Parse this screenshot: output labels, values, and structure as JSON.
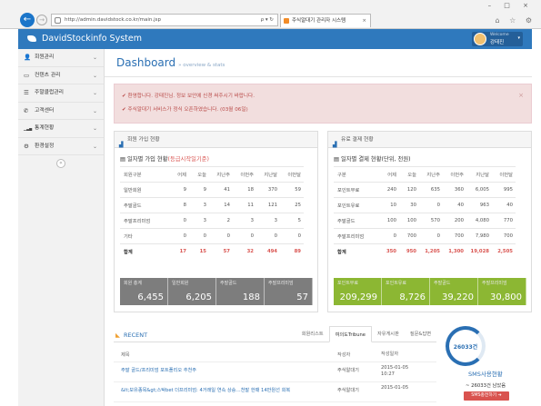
{
  "browser": {
    "url": "http://admin.davidstock.co.kr/main.jsp",
    "addr_tools": "ρ ▾ ↻",
    "tab_title": "주식알대기 관리자 시스템",
    "tab_close": "×",
    "window_controls": "– □ ×",
    "toolbar_icons": "⌂ ☆ ⚙"
  },
  "app": {
    "brand": "DavidStockinfo System",
    "user_welcome": "Welcome",
    "user_name": "강태진"
  },
  "sidebar": {
    "items": [
      {
        "icon": "person-icon",
        "glyph": "👤",
        "label": "회원관리"
      },
      {
        "icon": "monitor-icon",
        "glyph": "▭",
        "label": "컨텐츠 관리"
      },
      {
        "icon": "list-icon",
        "glyph": "☰",
        "label": "주말클럽관리"
      },
      {
        "icon": "phone-icon",
        "glyph": "✆",
        "label": "고객센터"
      },
      {
        "icon": "bar-chart-icon",
        "glyph": "▁▃▅",
        "label": "통계현황"
      },
      {
        "icon": "gears-icon",
        "glyph": "⚙",
        "label": "환경설정"
      }
    ],
    "collapse_glyph": "«"
  },
  "page": {
    "title": "Dashboard",
    "subtitle": "» overview & stats"
  },
  "alert": {
    "line1": "✔ 환영합니다. 강태진님. 정보 보안에 신경 써주시기 바랍니다.",
    "line2": "✔ 주식알대기 서비스가 정식 오픈하였습니다. (03월 06일)",
    "close": "×"
  },
  "members": {
    "header": "회원 가입 현황",
    "title": "일자별 가입 현황",
    "title_note": "(등급시작일기준)",
    "columns": [
      "회원구분",
      "어제",
      "오늘",
      "지난주",
      "이번주",
      "지난달",
      "이번달"
    ],
    "rows": [
      [
        "일반회원",
        "9",
        "9",
        "41",
        "18",
        "370",
        "59"
      ],
      [
        "주말골드",
        "8",
        "3",
        "14",
        "11",
        "121",
        "25"
      ],
      [
        "주말프리미엄",
        "0",
        "3",
        "2",
        "3",
        "3",
        "5"
      ],
      [
        "기타",
        "0",
        "0",
        "0",
        "0",
        "0",
        "0"
      ]
    ],
    "total": [
      "합계",
      "17",
      "15",
      "57",
      "32",
      "494",
      "89"
    ],
    "stats": [
      {
        "label": "회원 총계",
        "value": "6,455"
      },
      {
        "label": "일반회원",
        "value": "6,205"
      },
      {
        "label": "주말골드",
        "value": "188"
      },
      {
        "label": "주말프리미엄",
        "value": "57"
      }
    ]
  },
  "payments": {
    "header": "유료 결제 현황",
    "title": "일자별 결제 현황(단위, 천원)",
    "columns": [
      "구분",
      "어제",
      "오늘",
      "지난주",
      "이번주",
      "지난달",
      "이번달"
    ],
    "rows": [
      [
        "포인트무료",
        "240",
        "120",
        "635",
        "360",
        "6,005",
        "995"
      ],
      [
        "포인트유료",
        "10",
        "30",
        "0",
        "40",
        "963",
        "40"
      ],
      [
        "주말골드",
        "100",
        "100",
        "570",
        "200",
        "4,080",
        "770"
      ],
      [
        "주말프리미엄",
        "0",
        "700",
        "0",
        "700",
        "7,980",
        "700"
      ]
    ],
    "total": [
      "합계",
      "350",
      "950",
      "1,205",
      "1,300",
      "19,028",
      "2,505"
    ],
    "stats": [
      {
        "label": "포인트무료",
        "value": "209,299"
      },
      {
        "label": "포인트유료",
        "value": "8,726"
      },
      {
        "label": "주말골드",
        "value": "39,220"
      },
      {
        "label": "주말프리미엄",
        "value": "30,800"
      }
    ]
  },
  "recent": {
    "title": "RECENT",
    "tabs": [
      "회원리스트",
      "여의도Tribune",
      "자유게시판",
      "질문&답변"
    ],
    "active_tab": 1,
    "columns": [
      "제목",
      "작성자",
      "작성일자"
    ],
    "rows": [
      {
        "title": "주말 골드/프리미엄 포트폴리오 추천주",
        "author": "주식알대기",
        "date": "2015-01-05 10:27"
      },
      {
        "title": "&lt;보유종목&gt;스탁bet 더프리미엄: 4거래일 연속 상승…천말 한때 14만원선 회복",
        "author": "주식알대기",
        "date": "2015-01-05"
      }
    ]
  },
  "sms": {
    "count": "26033건",
    "label": "SMS사용현황",
    "remaining": "~ 26033건 남았음",
    "button": "SMS충전하기 ➔"
  }
}
